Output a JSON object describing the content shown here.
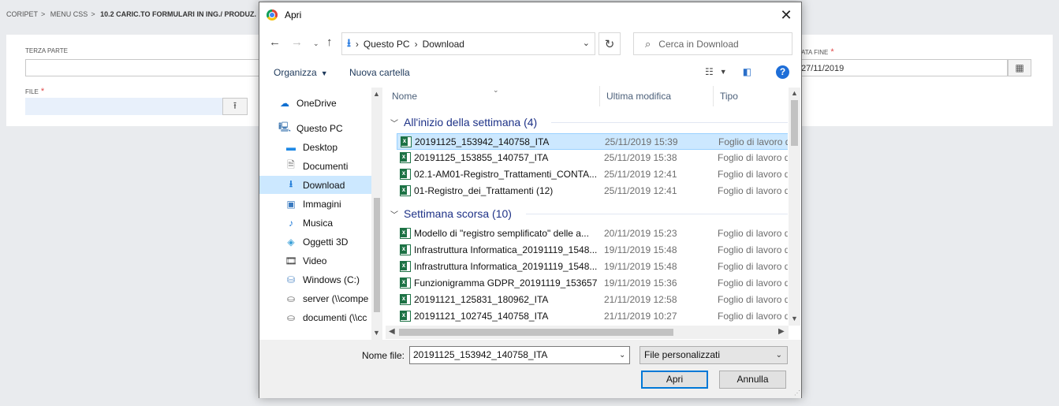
{
  "app": {
    "breadcrumb": [
      "CORIPET",
      "MENU CSS",
      "10.2 CARIC.TO FORMULARI IN ING./ PRODUZ."
    ],
    "terza_parte_label": "TERZA PARTE",
    "file_label": "FILE",
    "data_fine_label": "ATA FINE",
    "data_fine_value": "27/11/2019",
    "required_mark": "*",
    "upload_icon": "upload-icon",
    "calendar_icon": "calendar-icon"
  },
  "dialog": {
    "title": "Apri",
    "close": "✕",
    "address": {
      "segments": [
        "Questo PC",
        "Download"
      ]
    },
    "search_placeholder": "Cerca in Download",
    "toolbar": {
      "organizza": "Organizza",
      "nuova_cartella": "Nuova cartella",
      "help": "?"
    },
    "columns": {
      "name": "Nome",
      "date": "Ultima modifica",
      "type": "Tipo"
    },
    "nav": [
      {
        "label": "OneDrive",
        "icon": "cloud-icon"
      },
      {
        "label": "Questo PC",
        "icon": "computer-icon"
      },
      {
        "label": "Desktop",
        "icon": "desktop-icon"
      },
      {
        "label": "Documenti",
        "icon": "documents-icon"
      },
      {
        "label": "Download",
        "icon": "download-icon",
        "selected": true
      },
      {
        "label": "Immagini",
        "icon": "pictures-icon"
      },
      {
        "label": "Musica",
        "icon": "music-icon"
      },
      {
        "label": "Oggetti 3D",
        "icon": "objects3d-icon"
      },
      {
        "label": "Video",
        "icon": "video-icon"
      },
      {
        "label": "Windows (C:)",
        "icon": "drive-icon"
      },
      {
        "label": "server (\\\\compe",
        "icon": "network-drive-icon"
      },
      {
        "label": "documenti (\\\\cc",
        "icon": "network-drive-icon"
      }
    ],
    "groups": [
      {
        "title": "All'inizio della settimana (4)",
        "files": [
          {
            "name": "20191125_153942_140758_ITA",
            "date": "25/11/2019 15:39",
            "type": "Foglio di lavoro di",
            "selected": true
          },
          {
            "name": "20191125_153855_140757_ITA",
            "date": "25/11/2019 15:38",
            "type": "Foglio di lavoro di"
          },
          {
            "name": "02.1-AM01-Registro_Trattamenti_CONTA...",
            "date": "25/11/2019 12:41",
            "type": "Foglio di lavoro di"
          },
          {
            "name": "01-Registro_dei_Trattamenti (12)",
            "date": "25/11/2019 12:41",
            "type": "Foglio di lavoro di"
          }
        ]
      },
      {
        "title": "Settimana scorsa (10)",
        "files": [
          {
            "name": "Modello di \"registro semplificato\" delle a...",
            "date": "20/11/2019 15:23",
            "type": "Foglio di lavoro di"
          },
          {
            "name": "Infrastruttura Informatica_20191119_1548...",
            "date": "19/11/2019 15:48",
            "type": "Foglio di lavoro di"
          },
          {
            "name": "Infrastruttura Informatica_20191119_1548...",
            "date": "19/11/2019 15:48",
            "type": "Foglio di lavoro di"
          },
          {
            "name": "Funzionigramma GDPR_20191119_153657",
            "date": "19/11/2019 15:36",
            "type": "Foglio di lavoro di"
          },
          {
            "name": "20191121_125831_180962_ITA",
            "date": "21/11/2019 12:58",
            "type": "Foglio di lavoro di"
          },
          {
            "name": "20191121_102745_140758_ITA",
            "date": "21/11/2019 10:27",
            "type": "Foglio di lavoro di"
          }
        ]
      }
    ],
    "footer": {
      "filename_label": "Nome file:",
      "filename_value": "20191125_153942_140758_ITA",
      "filetype": "File personalizzati",
      "open_button": "Apri",
      "cancel_button": "Annulla"
    }
  }
}
